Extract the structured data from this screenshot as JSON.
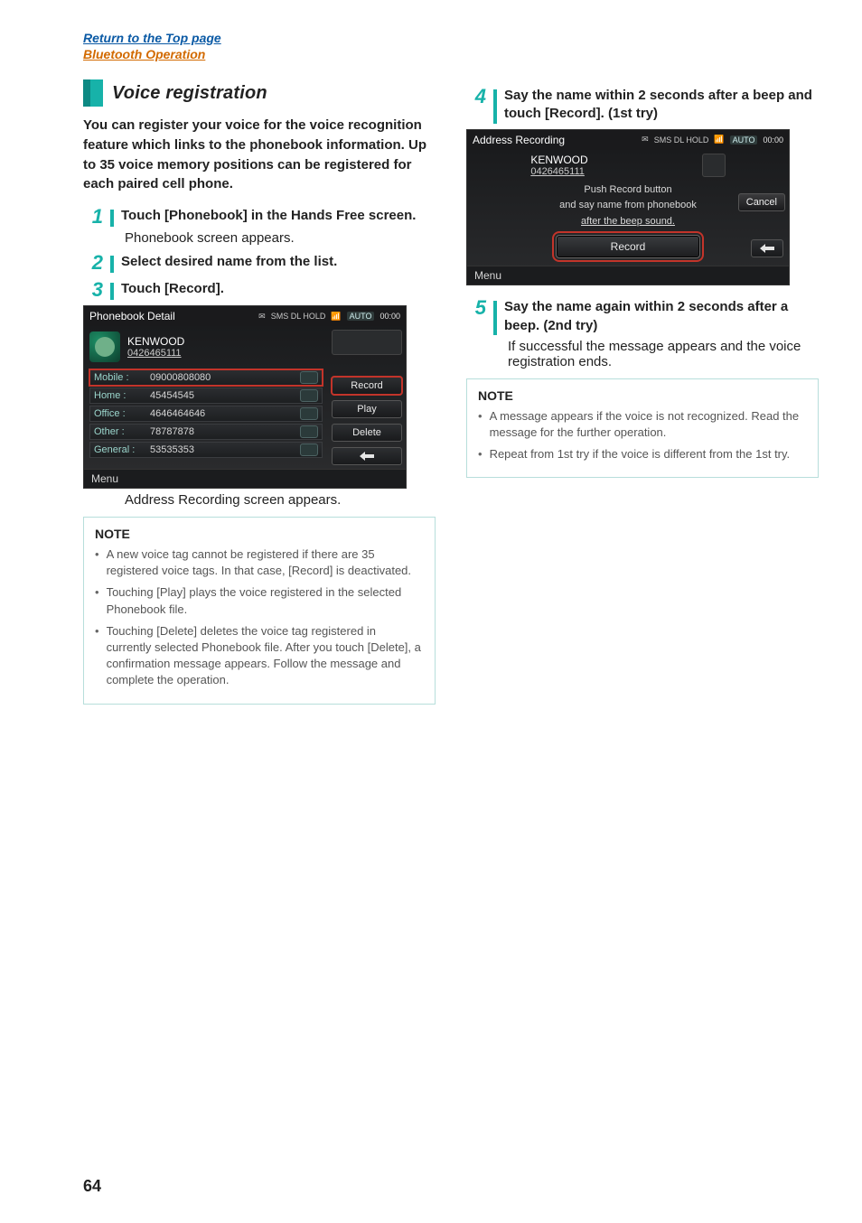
{
  "links": {
    "top": "Return to the Top page",
    "section": "Bluetooth Operation"
  },
  "section_title": "Voice registration",
  "intro": "You can register your voice for the voice recognition feature which links to the phonebook information. Up to 35 voice memory positions can be registered for each paired cell phone.",
  "steps": {
    "s1": {
      "num": "1",
      "text": "Touch [Phonebook] in the Hands Free screen.",
      "sub": "Phonebook screen appears."
    },
    "s2": {
      "num": "2",
      "text": "Select desired name from the list."
    },
    "s3": {
      "num": "3",
      "text": "Touch [Record]."
    },
    "s3_sub": "Address Recording screen appears.",
    "s4": {
      "num": "4",
      "text": "Say the name within 2 seconds after a beep and touch [Record]. (1st try)"
    },
    "s5": {
      "num": "5",
      "text": "Say the name again within 2 seconds after a beep. (2nd try)",
      "sub": "If successful the message appears and the voice registration ends."
    }
  },
  "ss1": {
    "title": "Phonebook Detail",
    "status": "SMS DL HOLD",
    "tout": "Tout",
    "auto": "AUTO",
    "clock": "00:00",
    "name": "KENWOOD",
    "number": "0426465111",
    "rows": [
      {
        "lbl": "Mobile :",
        "val": "09000808080"
      },
      {
        "lbl": "Home :",
        "val": "45454545"
      },
      {
        "lbl": "Office :",
        "val": "4646464646"
      },
      {
        "lbl": "Other :",
        "val": "78787878"
      },
      {
        "lbl": "General :",
        "val": "53535353"
      }
    ],
    "btn_record": "Record",
    "btn_play": "Play",
    "btn_delete": "Delete",
    "menu": "Menu"
  },
  "ss2": {
    "title": "Address Recording",
    "status": "SMS DL HOLD",
    "tout": "Tout",
    "auto": "AUTO",
    "clock": "00:00",
    "name": "KENWOOD",
    "number": "0426465111",
    "line1": "Push Record button",
    "line2": "and say name from phonebook",
    "line3": "after the beep sound.",
    "cancel": "Cancel",
    "record": "Record",
    "menu": "Menu"
  },
  "note1": {
    "title": "NOTE",
    "items": [
      "A new voice tag cannot be registered if there are 35 registered voice tags. In that case, [Record] is deactivated.",
      "Touching [Play] plays the voice registered in the selected Phonebook file.",
      "Touching [Delete] deletes the voice tag registered in currently selected Phonebook file. After you touch [Delete], a confirmation message appears. Follow the message and complete the operation."
    ]
  },
  "note2": {
    "title": "NOTE",
    "items": [
      "A message appears if the voice is not recognized. Read the message for the further operation.",
      "Repeat from 1st try if the voice is different from the 1st try."
    ]
  },
  "page_number": "64"
}
